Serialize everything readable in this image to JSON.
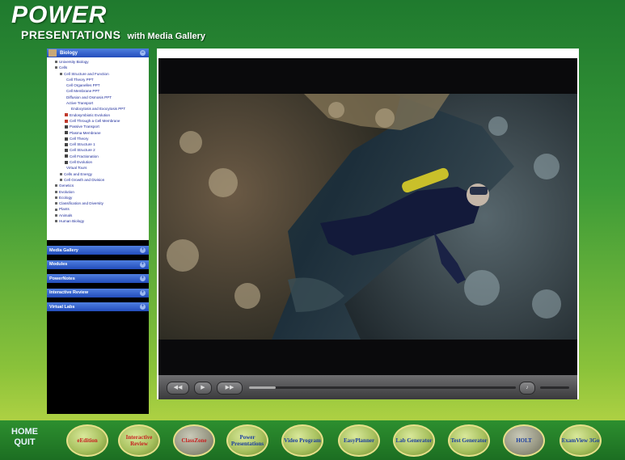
{
  "brand": {
    "title_big": "POWER",
    "title_sub": "PRESENTATIONS",
    "tagline": "with Media Gallery"
  },
  "sidebar": {
    "tree_header": "Biology",
    "tree_items": [
      {
        "label": "University Biology",
        "kind": "bullet",
        "indent": 1
      },
      {
        "label": "Cells",
        "kind": "bullet",
        "indent": 1
      },
      {
        "label": "Cell Structure and Function",
        "kind": "bullet",
        "indent": 2
      },
      {
        "label": "Cell Theory PPT",
        "kind": "text",
        "indent": 3
      },
      {
        "label": "Cell Organelles PPT",
        "kind": "text",
        "indent": 3
      },
      {
        "label": "Cell Membrane PPT",
        "kind": "text",
        "indent": 3
      },
      {
        "label": "Diffusion and Osmosis PPT",
        "kind": "text",
        "indent": 3
      },
      {
        "label": "Active Transport",
        "kind": "text",
        "indent": 3
      },
      {
        "label": "Endocytosis and Exocytosis PPT",
        "kind": "text",
        "indent": 4
      },
      {
        "label": "Endosymbiotic Evolution",
        "kind": "red",
        "indent": 3
      },
      {
        "label": "Cell Through a Cell Membrane",
        "kind": "red",
        "indent": 3
      },
      {
        "label": "Passive Transport",
        "kind": "dark",
        "indent": 3
      },
      {
        "label": "Plasma Membrane",
        "kind": "dark",
        "indent": 3
      },
      {
        "label": "Cell Theory",
        "kind": "dark",
        "indent": 3
      },
      {
        "label": "Cell Structure 1",
        "kind": "dark",
        "indent": 3
      },
      {
        "label": "Cell Structure 2",
        "kind": "dark",
        "indent": 3
      },
      {
        "label": "Cell Fractionation",
        "kind": "dark",
        "indent": 3
      },
      {
        "label": "Cell Evolution",
        "kind": "dark",
        "indent": 3
      },
      {
        "label": "Virtual Tours",
        "kind": "text",
        "indent": 3
      },
      {
        "label": "Cells and Energy",
        "kind": "bullet",
        "indent": 2
      },
      {
        "label": "Cell Growth and Division",
        "kind": "bullet",
        "indent": 2
      },
      {
        "label": "Genetics",
        "kind": "bullet",
        "indent": 1
      },
      {
        "label": "Evolution",
        "kind": "bullet",
        "indent": 1
      },
      {
        "label": "Ecology",
        "kind": "bullet",
        "indent": 1
      },
      {
        "label": "Classification and Diversity",
        "kind": "bullet",
        "indent": 1
      },
      {
        "label": "Plants",
        "kind": "bullet",
        "indent": 1
      },
      {
        "label": "Animals",
        "kind": "bullet",
        "indent": 1
      },
      {
        "label": "Human Biology",
        "kind": "bullet",
        "indent": 1
      }
    ],
    "accordions": [
      "Media Gallery",
      "Modules",
      "PowerNotes",
      "Interactive Review",
      "Virtual Labs"
    ]
  },
  "video": {
    "progress": 0.1,
    "controls": {
      "rewind": "◀◀",
      "play": "▶",
      "forward": "▶▶",
      "volume_icon": "speaker-icon"
    }
  },
  "bottom_nav": {
    "home_line1": "HOME",
    "home_line2": "QUIT",
    "buttons": [
      {
        "label": "eEdition",
        "color": "red"
      },
      {
        "label": "Interactive Review",
        "color": "red"
      },
      {
        "label": "ClassZone",
        "color": "red"
      },
      {
        "label": "Power Presentations",
        "color": "blue"
      },
      {
        "label": "Video Program",
        "color": "blue"
      },
      {
        "label": "EasyPlanner",
        "color": "blue"
      },
      {
        "label": "Lab Generator",
        "color": "blue"
      },
      {
        "label": "Test Generator",
        "color": "blue"
      },
      {
        "label": "HOLT",
        "color": "blue"
      },
      {
        "label": "ExamView 3Go",
        "color": "blue"
      }
    ]
  }
}
